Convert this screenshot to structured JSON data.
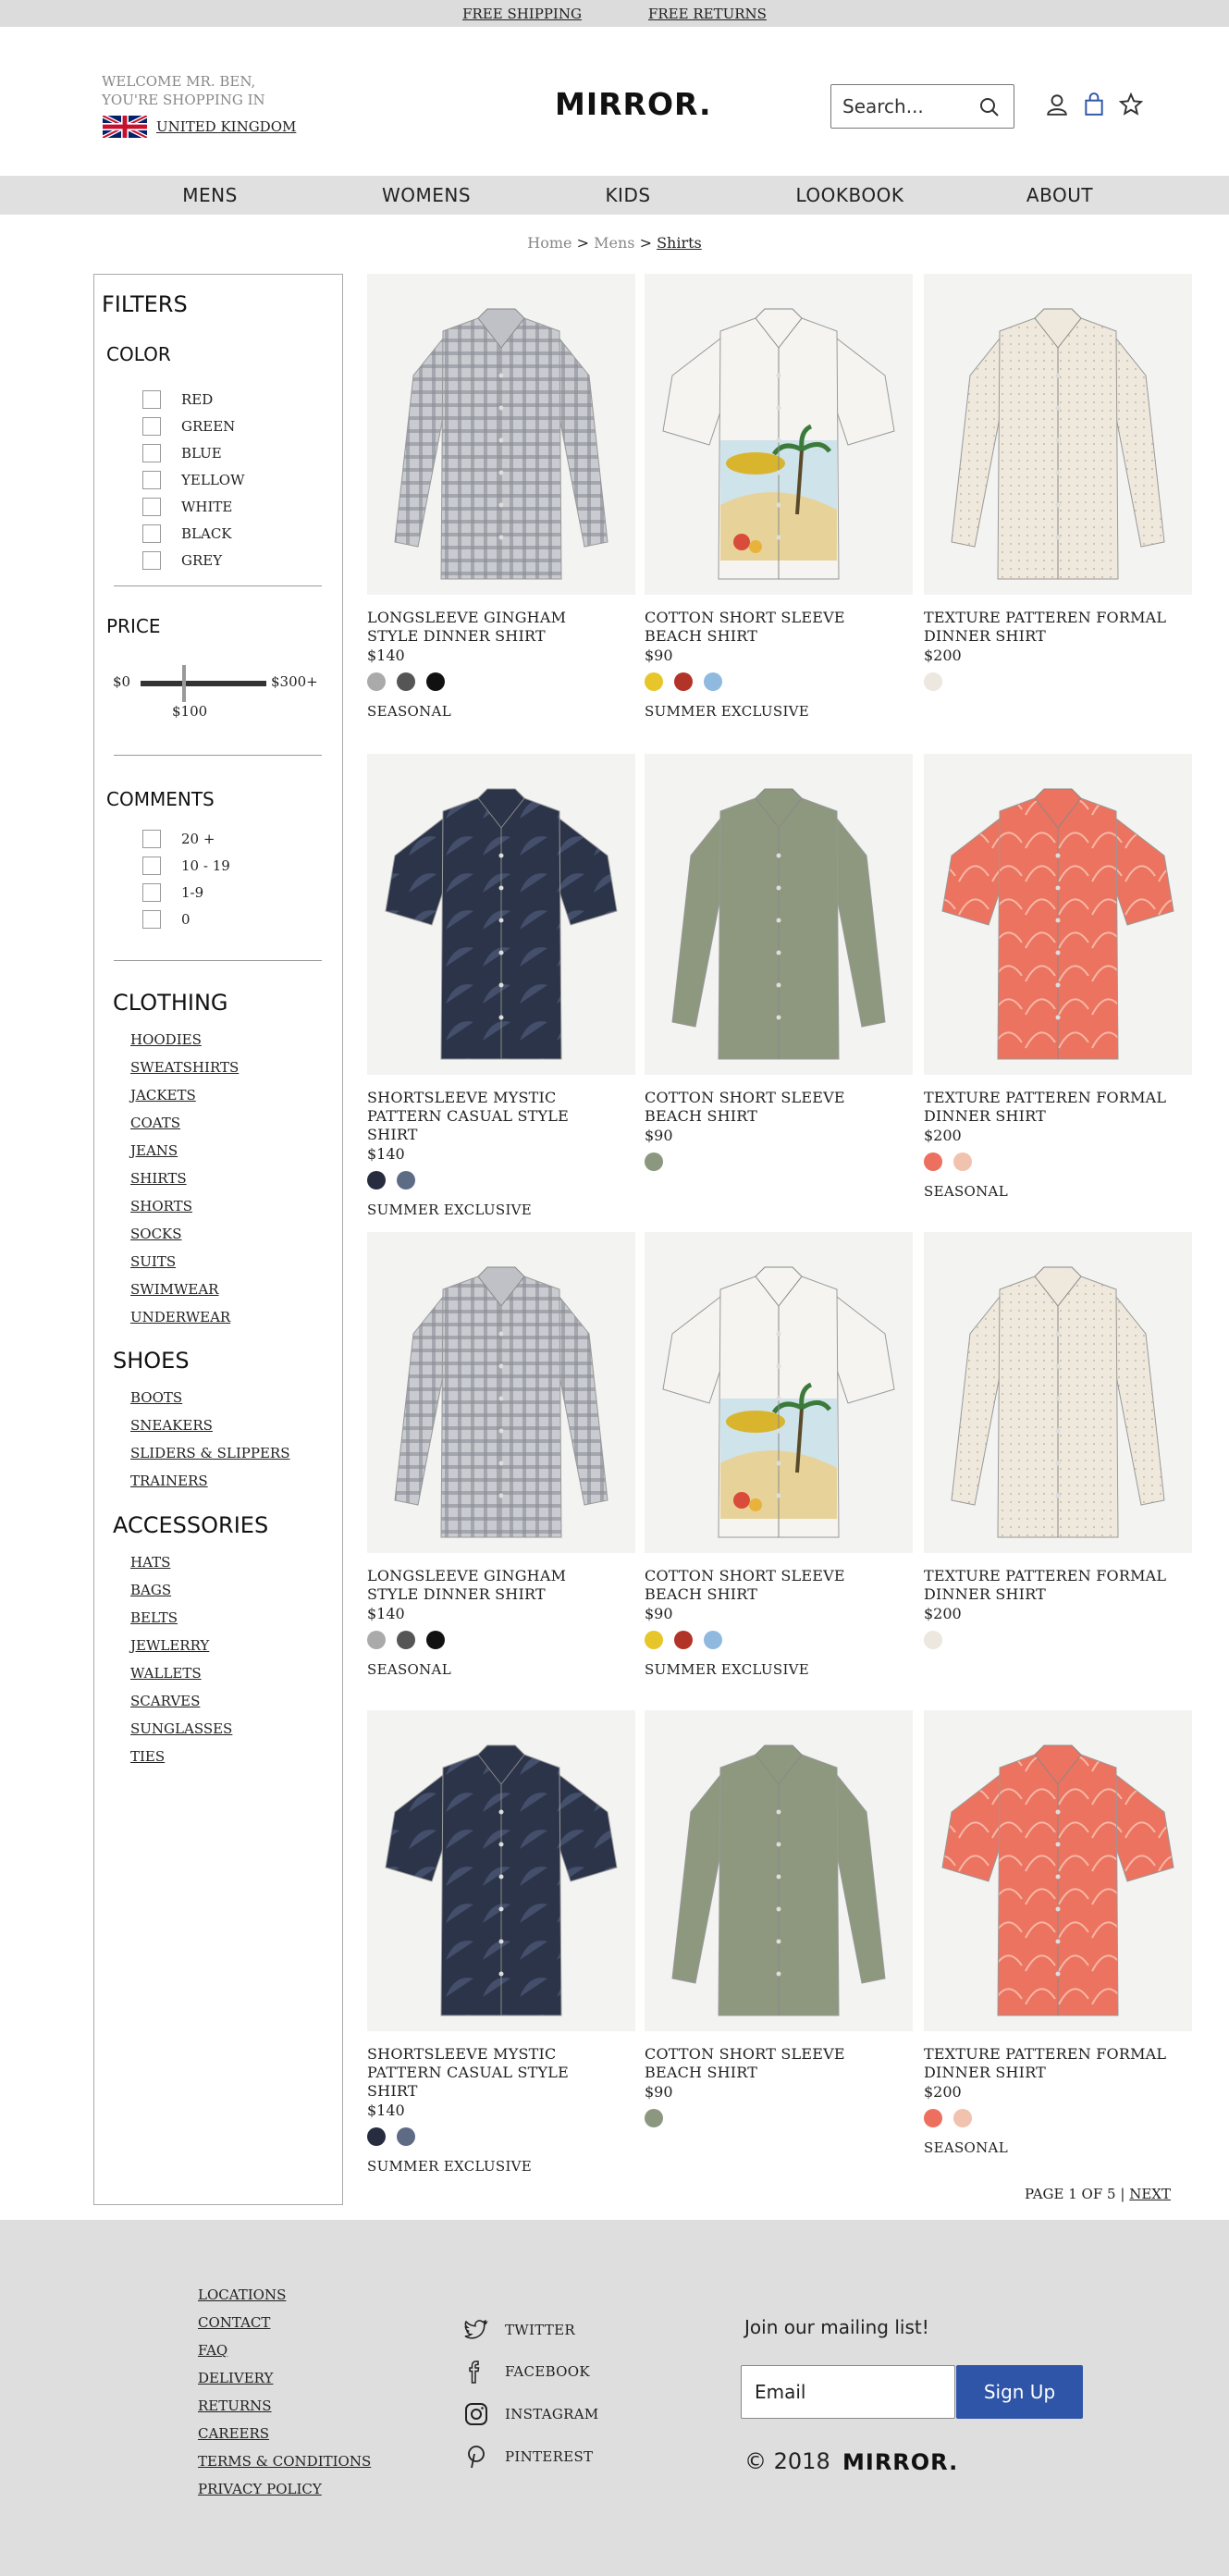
{
  "topbar": {
    "shipping": "FREE SHIPPING",
    "returns": "FREE RETURNS"
  },
  "header": {
    "welcome_line1": "WELCOME MR. BEN,",
    "welcome_line2": "YOU'RE SHOPPING IN",
    "country": "UNITED KINGDOM",
    "logo": "MIRROR.",
    "search_placeholder": "Search..."
  },
  "nav": [
    "MENS",
    "WOMENS",
    "KIDS",
    "LOOKBOOK",
    "ABOUT"
  ],
  "breadcrumb": {
    "home": "Home",
    "mens": "Mens",
    "current": "Shirts",
    "sep": ">"
  },
  "filters": {
    "title": "FILTERS",
    "color_title": "COLOR",
    "colors": [
      "RED",
      "GREEN",
      "BLUE",
      "YELLOW",
      "WHITE",
      "BLACK",
      "GREY"
    ],
    "price_title": "PRICE",
    "price_min": "$0",
    "price_max": "$300+",
    "price_value": "$100",
    "price_value_fraction": 0.33,
    "comments_title": "COMMENTS",
    "comments": [
      "20 +",
      "10 - 19",
      "1-9",
      "0"
    ],
    "clothing_title": "CLOTHING",
    "clothing": [
      "HOODIES",
      "SWEATSHIRTS",
      "JACKETS",
      "COATS",
      "JEANS",
      "SHIRTS",
      "SHORTS",
      "SOCKS",
      "SUITS",
      "SWIMWEAR",
      "UNDERWEAR"
    ],
    "shoes_title": "SHOES",
    "shoes": [
      "BOOTS",
      "SNEAKERS",
      "SLIDERS & SLIPPERS",
      "TRAINERS"
    ],
    "accessories_title": "ACCESSORIES",
    "accessories": [
      "HATS",
      "BAGS",
      "BELTS",
      "JEWLERRY",
      "WALLETS",
      "SCARVES",
      "SUNGLASSES",
      "TIES"
    ]
  },
  "products": [
    {
      "name": "LONGSLEEVE GINGHAM STYLE DINNER SHIRT",
      "price": "$140",
      "swatches": [
        "#aaaaaa",
        "#555555",
        "#111111"
      ],
      "tag": "SEASONAL",
      "image": "gingham-shirt"
    },
    {
      "name": "COTTON SHORT SLEEVE BEACH SHIRT",
      "price": "$90",
      "swatches": [
        "#e6c62a",
        "#b23327",
        "#8fb9df"
      ],
      "tag": "SUMMER EXCLUSIVE",
      "image": "beach-shirt"
    },
    {
      "name": "TEXTURE PATTEREN FORMAL DINNER SHIRT",
      "price": "$200",
      "swatches": [
        "#ece7df"
      ],
      "tag": "",
      "image": "cream-shirt"
    },
    {
      "name": "SHORTSLEEVE MYSTIC PATTERN CASUAL STYLE SHIRT",
      "price": "$140",
      "swatches": [
        "#272c3f",
        "#5e6b85"
      ],
      "tag": "SUMMER EXCLUSIVE",
      "image": "navy-shirt"
    },
    {
      "name": "COTTON SHORT SLEEVE BEACH SHIRT",
      "price": "$90",
      "swatches": [
        "#8c9780"
      ],
      "tag": "",
      "image": "green-shirt"
    },
    {
      "name": "TEXTURE PATTEREN FORMAL DINNER SHIRT",
      "price": "$200",
      "swatches": [
        "#ec6f5f",
        "#f1c2ae"
      ],
      "tag": "SEASONAL",
      "image": "coral-shirt"
    },
    {
      "name": "LONGSLEEVE GINGHAM STYLE DINNER SHIRT",
      "price": "$140",
      "swatches": [
        "#aaaaaa",
        "#555555",
        "#111111"
      ],
      "tag": "SEASONAL",
      "image": "gingham-shirt"
    },
    {
      "name": "COTTON SHORT SLEEVE BEACH SHIRT",
      "price": "$90",
      "swatches": [
        "#e6c62a",
        "#b23327",
        "#8fb9df"
      ],
      "tag": "SUMMER EXCLUSIVE",
      "image": "beach-shirt"
    },
    {
      "name": "TEXTURE PATTEREN FORMAL DINNER SHIRT",
      "price": "$200",
      "swatches": [
        "#ece7df"
      ],
      "tag": "",
      "image": "cream-shirt"
    },
    {
      "name": "SHORTSLEEVE MYSTIC PATTERN CASUAL STYLE SHIRT",
      "price": "$140",
      "swatches": [
        "#272c3f",
        "#5e6b85"
      ],
      "tag": "SUMMER EXCLUSIVE",
      "image": "navy-shirt"
    },
    {
      "name": "COTTON SHORT SLEEVE BEACH SHIRT",
      "price": "$90",
      "swatches": [
        "#8c9780"
      ],
      "tag": "",
      "image": "green-shirt"
    },
    {
      "name": "TEXTURE PATTEREN FORMAL DINNER SHIRT",
      "price": "$200",
      "swatches": [
        "#ec6f5f",
        "#f1c2ae"
      ],
      "tag": "SEASONAL",
      "image": "coral-shirt"
    }
  ],
  "pagination": {
    "label": "PAGE 1 OF 5",
    "sep": "|",
    "next": "NEXT"
  },
  "footer": {
    "links": [
      "LOCATIONS",
      "CONTACT",
      "FAQ",
      "DELIVERY",
      "RETURNS",
      "CAREERS",
      "TERMS & CONDITIONS",
      "PRIVACY POLICY"
    ],
    "social": [
      {
        "label": "TWITTER",
        "icon": "twitter-icon"
      },
      {
        "label": "FACEBOOK",
        "icon": "facebook-icon"
      },
      {
        "label": "INSTAGRAM",
        "icon": "instagram-icon"
      },
      {
        "label": "PINTEREST",
        "icon": "pinterest-icon"
      }
    ],
    "mailing_title": "Join our mailing list!",
    "email_placeholder": "Email",
    "signup_label": "Sign Up",
    "copyright": "© 2018",
    "logo": "MIRROR."
  },
  "colors": {
    "accent": "#2e55a8",
    "topbar": "#dcdcdc",
    "nav": "#e0e0e0",
    "footer": "#dedede"
  }
}
